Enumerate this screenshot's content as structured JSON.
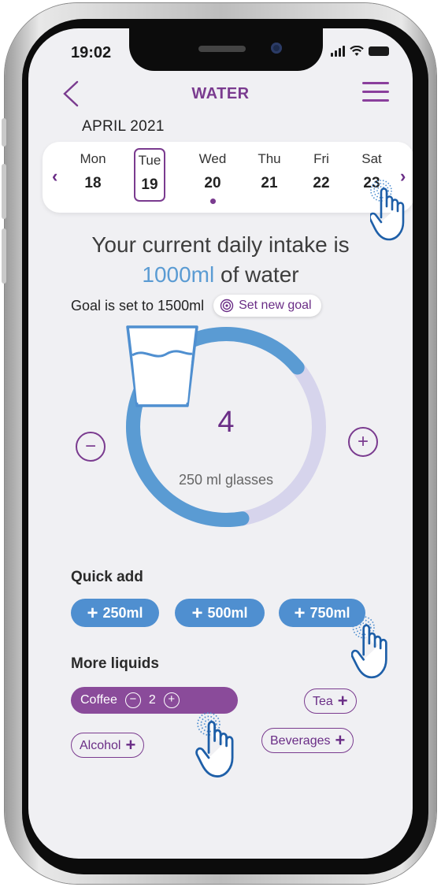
{
  "status": {
    "time": "19:02"
  },
  "header": {
    "title": "WATER"
  },
  "calendar": {
    "month_label": "APRIL  2021",
    "days": [
      {
        "name": "Mon",
        "date": "18"
      },
      {
        "name": "Tue",
        "date": "19"
      },
      {
        "name": "Wed",
        "date": "20"
      },
      {
        "name": "Thu",
        "date": "21"
      },
      {
        "name": "Fri",
        "date": "22"
      },
      {
        "name": "Sat",
        "date": "23"
      }
    ],
    "selected_day": "Tue",
    "dot_day": "Wed"
  },
  "intake": {
    "line1": "Your current daily intake is",
    "amount": "1000ml",
    "suffix": " of water"
  },
  "goal": {
    "text": "Goal is set to  1500ml",
    "button_label": "Set new goal"
  },
  "glasses": {
    "count": "4",
    "label": "250 ml glasses",
    "progress_fraction": 0.667
  },
  "quick_add": {
    "title": "Quick add",
    "buttons": [
      "250ml",
      "500ml",
      "750ml"
    ]
  },
  "more_liquids": {
    "title": "More liquids",
    "active": {
      "label": "Coffee",
      "count": "2"
    },
    "chips": [
      "Tea",
      "Alcohol",
      "Beverages"
    ]
  },
  "colors": {
    "accent_purple": "#7a3b8f",
    "accent_blue": "#5a9bd3",
    "ring_remaining": "#d6d4ec",
    "background": "#f0f0f3"
  },
  "icons": [
    "back-chevron-icon",
    "hamburger-menu-icon",
    "target-icon",
    "water-glass-icon",
    "minus-icon",
    "plus-icon",
    "tap-hand-icon"
  ]
}
